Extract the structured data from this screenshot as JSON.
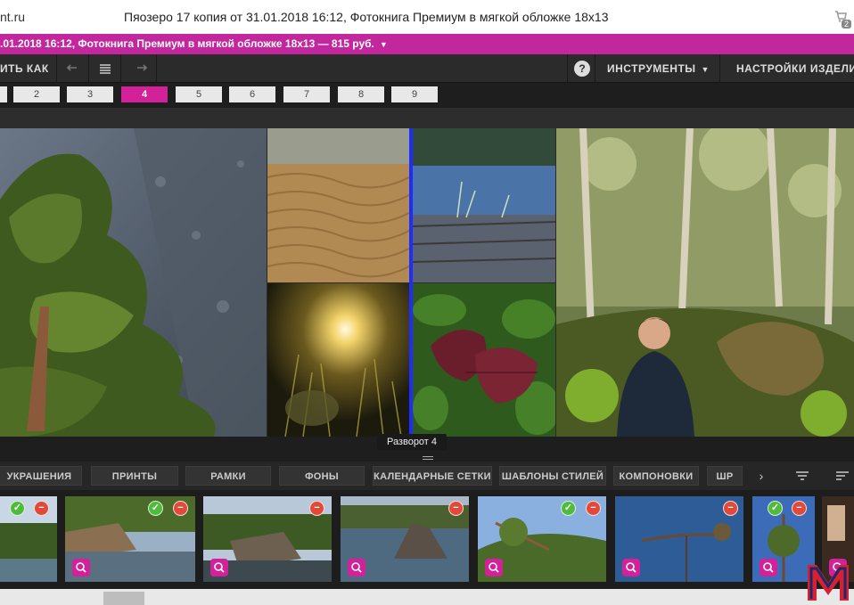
{
  "window": {
    "site": "nt.ru",
    "title": "Пяозеро 17 копия от 31.01.2018 16:12, Фотокнига Премиум в мягкой обложке 18х13",
    "cart_count": "2"
  },
  "product_bar": {
    "text": ".01.2018 16:12, Фотокнига Премиум в мягкой обложке 18х13  —  815 руб."
  },
  "toolbar": {
    "save_label": "ИТЬ КАК",
    "undo_icon": "undo-icon",
    "list_icon": "list-icon",
    "redo_icon": "redo-icon",
    "help_label": "?",
    "tools_label": "ИНСТРУМЕНТЫ",
    "settings_label": "НАСТРОЙКИ ИЗДЕЛИЯ"
  },
  "pages": {
    "tabs": [
      "",
      "2",
      "3",
      "4",
      "5",
      "6",
      "7",
      "8",
      "9"
    ],
    "active": "4"
  },
  "spread": {
    "label": "Разворот 4"
  },
  "categories": {
    "items": [
      "УКРАШЕНИЯ",
      "ПРИНТЫ",
      "РАМКИ",
      "ФОНЫ",
      "КАЛЕНДАРНЫЕ СЕТКИ",
      "ШАБЛОНЫ СТИЛЕЙ",
      "КОМПОНОВКИ",
      "ШР"
    ],
    "next_icon": "chevron-right-icon",
    "filter_icon": "filter-icon",
    "sort_icon": "sort-icon"
  },
  "thumbnails": [
    {
      "name": "forest-shore",
      "used": true,
      "removable": true
    },
    {
      "name": "rock-lake",
      "used": true,
      "removable": true
    },
    {
      "name": "rocky-cliff",
      "used": false,
      "removable": true
    },
    {
      "name": "lake-rocks",
      "used": false,
      "removable": true
    },
    {
      "name": "pine-branch",
      "used": true,
      "removable": true
    },
    {
      "name": "pine-silhouette",
      "used": false,
      "removable": true
    },
    {
      "name": "pine-tree",
      "used": true,
      "removable": true
    },
    {
      "name": "partial",
      "used": false,
      "removable": false
    }
  ],
  "colors": {
    "accent": "#d3219a",
    "product_bar": "#c2279d",
    "spine": "#1e2dff",
    "ok": "#4fba3c",
    "remove": "#e04a3a"
  }
}
